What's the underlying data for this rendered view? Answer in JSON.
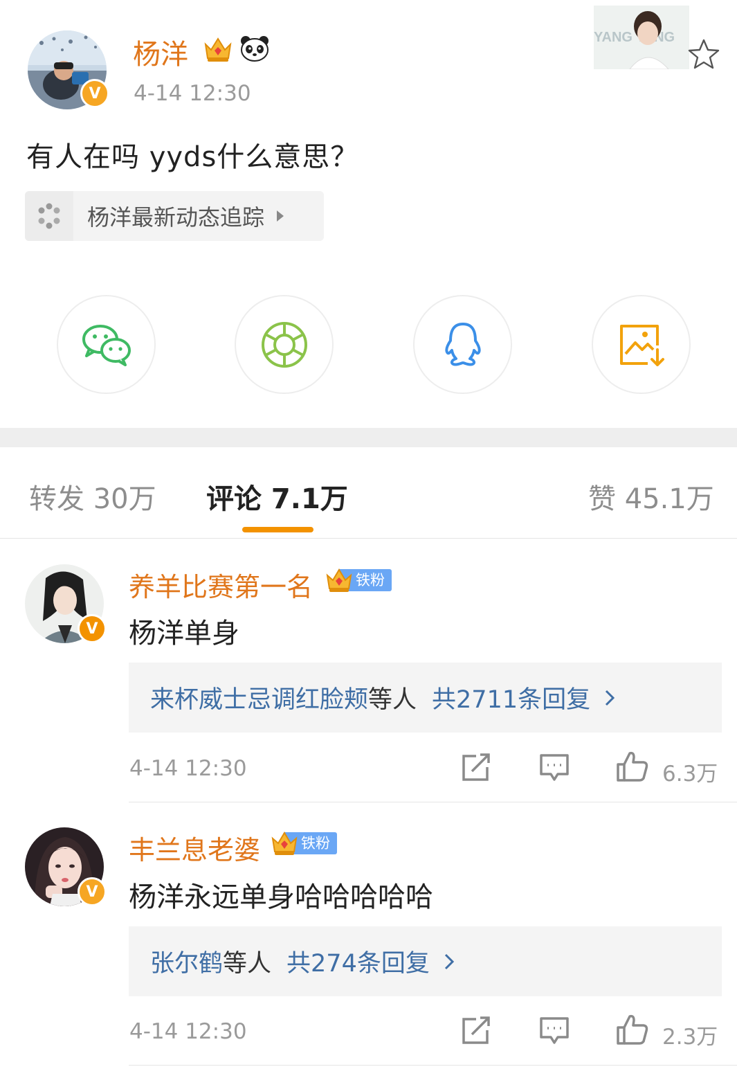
{
  "post": {
    "author": "杨洋",
    "time": "4-14 12:30",
    "text": "有人在吗 yyds什么意思？",
    "card_thumb_text": "YANG YANG",
    "topic_chip": "杨洋最新动态追踪"
  },
  "share": [
    {
      "name": "wechat-icon",
      "color": "#3fba63"
    },
    {
      "name": "moments-icon",
      "color": "#8bc34a"
    },
    {
      "name": "qq-icon",
      "color": "#3b8fe8"
    },
    {
      "name": "save-image-icon",
      "color": "#f2a20c"
    }
  ],
  "tabs": {
    "repost": "转发 30万",
    "comments": "评论 7.1万",
    "likes": "赞 45.1万"
  },
  "comments": [
    {
      "user": "养羊比赛第一名",
      "fan_badge": "铁粉",
      "text": "杨洋单身",
      "reply_users": "来杯威士忌调红脸颊",
      "reply_suffix": "等人",
      "reply_count": "共2711条回复",
      "time": "4-14 12:30",
      "likes": "6.3万"
    },
    {
      "user": "丰兰息老婆",
      "fan_badge": "铁粉",
      "text": "杨洋永远单身哈哈哈哈哈",
      "reply_users": "张尔鹤",
      "reply_suffix": "等人",
      "reply_count": "共274条回复",
      "time": "4-14 12:30",
      "likes": "2.3万"
    }
  ],
  "colors": {
    "accent_orange": "#f39200",
    "name_orange": "#e0761b",
    "link_blue": "#3f6ea5",
    "fan_blue": "#6aa7f5"
  }
}
